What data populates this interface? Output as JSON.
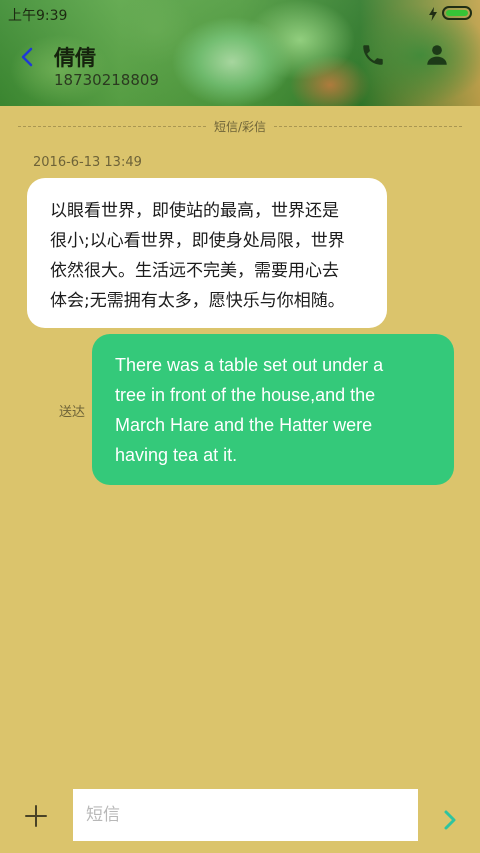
{
  "status_bar": {
    "time": "上午9:39",
    "battery_icon": "battery-charging-icon",
    "battery_color": "#36c436"
  },
  "header": {
    "contact_name": "倩倩",
    "contact_number": "18730218809",
    "back_icon": "chevron-left-icon",
    "back_color": "#1f39d6",
    "call_icon": "phone-icon",
    "contact_icon": "person-icon"
  },
  "thread": {
    "type_label": "短信/彩信",
    "messages": [
      {
        "direction": "incoming",
        "timestamp": "2016-6-13 13:49",
        "lines": [
          "以眼看世界，即使站的最高，世界还是",
          "很小;以心看世界，即使身处局限，世界",
          "依然很大。生活远不完美，需要用心去",
          "体会;无需拥有太多，愿快乐与你相随。"
        ]
      },
      {
        "direction": "outgoing",
        "status": "送达",
        "lines": [
          "There was a table set out under a",
          "tree in front of the house,and the",
          "March Hare and the Hatter were",
          "having tea at it."
        ]
      }
    ]
  },
  "composer": {
    "add_icon": "plus-icon",
    "input_placeholder": "短信",
    "input_value": "",
    "send_icon": "chevron-right-icon",
    "send_color": "#2ec4a0"
  },
  "colors": {
    "background": "#dbc46c",
    "incoming_bubble": "#ffffff",
    "outgoing_bubble": "#34c97a"
  }
}
